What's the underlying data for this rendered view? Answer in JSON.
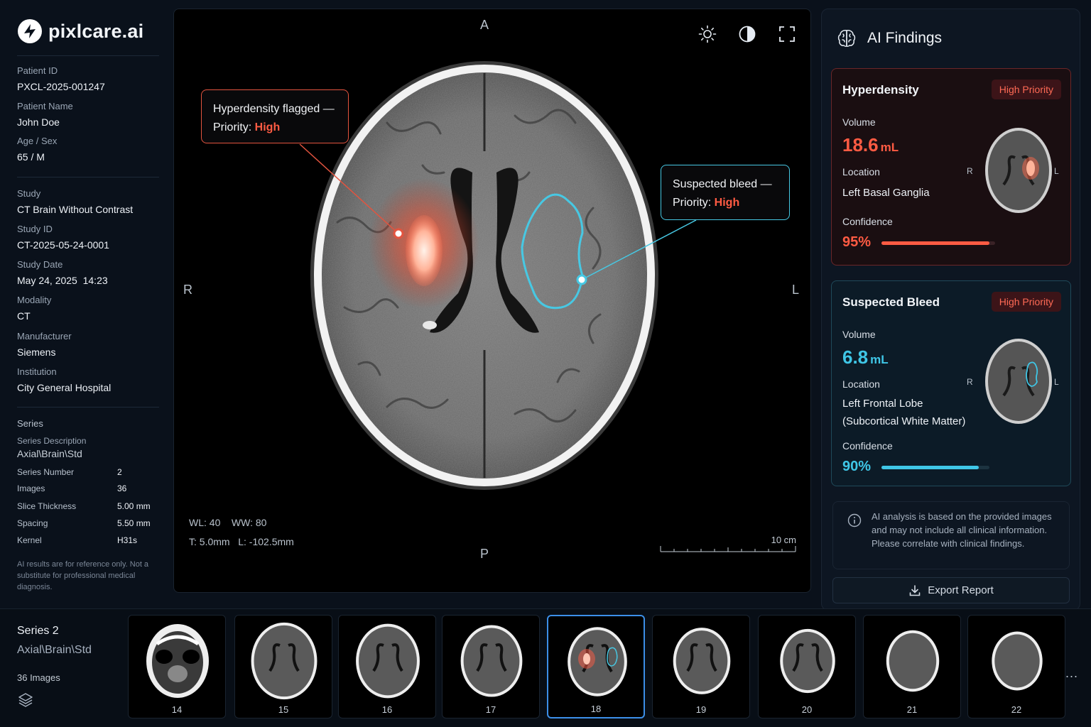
{
  "brand": {
    "name": "pixlcare.ai"
  },
  "patient": [
    {
      "label": "Patient ID",
      "value": "PXCL-2025-001247"
    },
    {
      "label": "Patient Name",
      "value": "John Doe"
    },
    {
      "label": "Age / Sex",
      "value": "65 / M"
    }
  ],
  "study": [
    {
      "label": "Study",
      "value": "CT Brain Without Contrast"
    },
    {
      "label": "Study ID",
      "value": "CT-2025-05-24-0001"
    },
    {
      "label": "Study Date",
      "value": "May 24, 2025  14:23"
    },
    {
      "label": "Modality",
      "value": "CT"
    },
    {
      "label": "Manufacturer",
      "value": "Siemens"
    },
    {
      "label": "Institution",
      "value": "City General Hospital"
    }
  ],
  "series": {
    "heading": "Series",
    "desc_label": "Series Description",
    "desc_value": "Axial\\Brain\\Std",
    "rows": [
      {
        "k": "Series Number",
        "v": "2"
      },
      {
        "k": "Images",
        "v": "36"
      },
      {
        "k": "Slice Thickness",
        "v": "5.00 mm"
      },
      {
        "k": "Spacing",
        "v": "5.50 mm"
      },
      {
        "k": "Kernel",
        "v": "H31s"
      }
    ]
  },
  "disclaimer_left": "AI results are for reference only. Not a substitute for professional medical diagnosis.",
  "viewer": {
    "orient": {
      "top": "A",
      "bottom": "P",
      "left": "R",
      "right": "L"
    },
    "wl_line": "WL: 40    WW: 80",
    "t_line": "T: 5.0mm   L: -102.5mm",
    "scale_label": "10 cm",
    "callout_hyper": {
      "line1": "Hyperdensity flagged —",
      "prefix": "Priority: ",
      "priority": "High"
    },
    "callout_bleed": {
      "line1": "Suspected bleed —",
      "prefix": "Priority: ",
      "priority": "High"
    },
    "colors": {
      "hyper": "#e3543f",
      "bleed": "#47c8e3"
    }
  },
  "findings": {
    "title": "AI Findings",
    "cards": [
      {
        "title": "Hyperdensity",
        "badge": "High Priority",
        "volume_label": "Volume",
        "volume": "18.6",
        "unit": "mL",
        "location_label": "Location",
        "location": "Left Basal Ganglia",
        "confidence_label": "Confidence",
        "confidence": "95%",
        "confidence_value": 0.95,
        "color": "#ff5b43"
      },
      {
        "title": "Suspected Bleed",
        "badge": "High Priority",
        "volume_label": "Volume",
        "volume": "6.8",
        "unit": "mL",
        "location_label": "Location",
        "location_1": "Left Frontal Lobe",
        "location_2": "(Subcortical White Matter)",
        "confidence_label": "Confidence",
        "confidence": "90%",
        "confidence_value": 0.9,
        "color": "#3fc6e6"
      }
    ],
    "mini_labels": {
      "r": "R",
      "l": "L"
    },
    "info": "AI analysis is based on the provided images and may not include all clinical information. Please correlate with clinical findings.",
    "export_label": "Export Report"
  },
  "strip": {
    "series_title": "Series 2",
    "series_desc": "Axial\\Brain\\Std",
    "image_count": "36 Images",
    "slices": [
      "14",
      "15",
      "16",
      "17",
      "18",
      "19",
      "20",
      "21",
      "22"
    ],
    "selected": "18",
    "more": "..."
  }
}
